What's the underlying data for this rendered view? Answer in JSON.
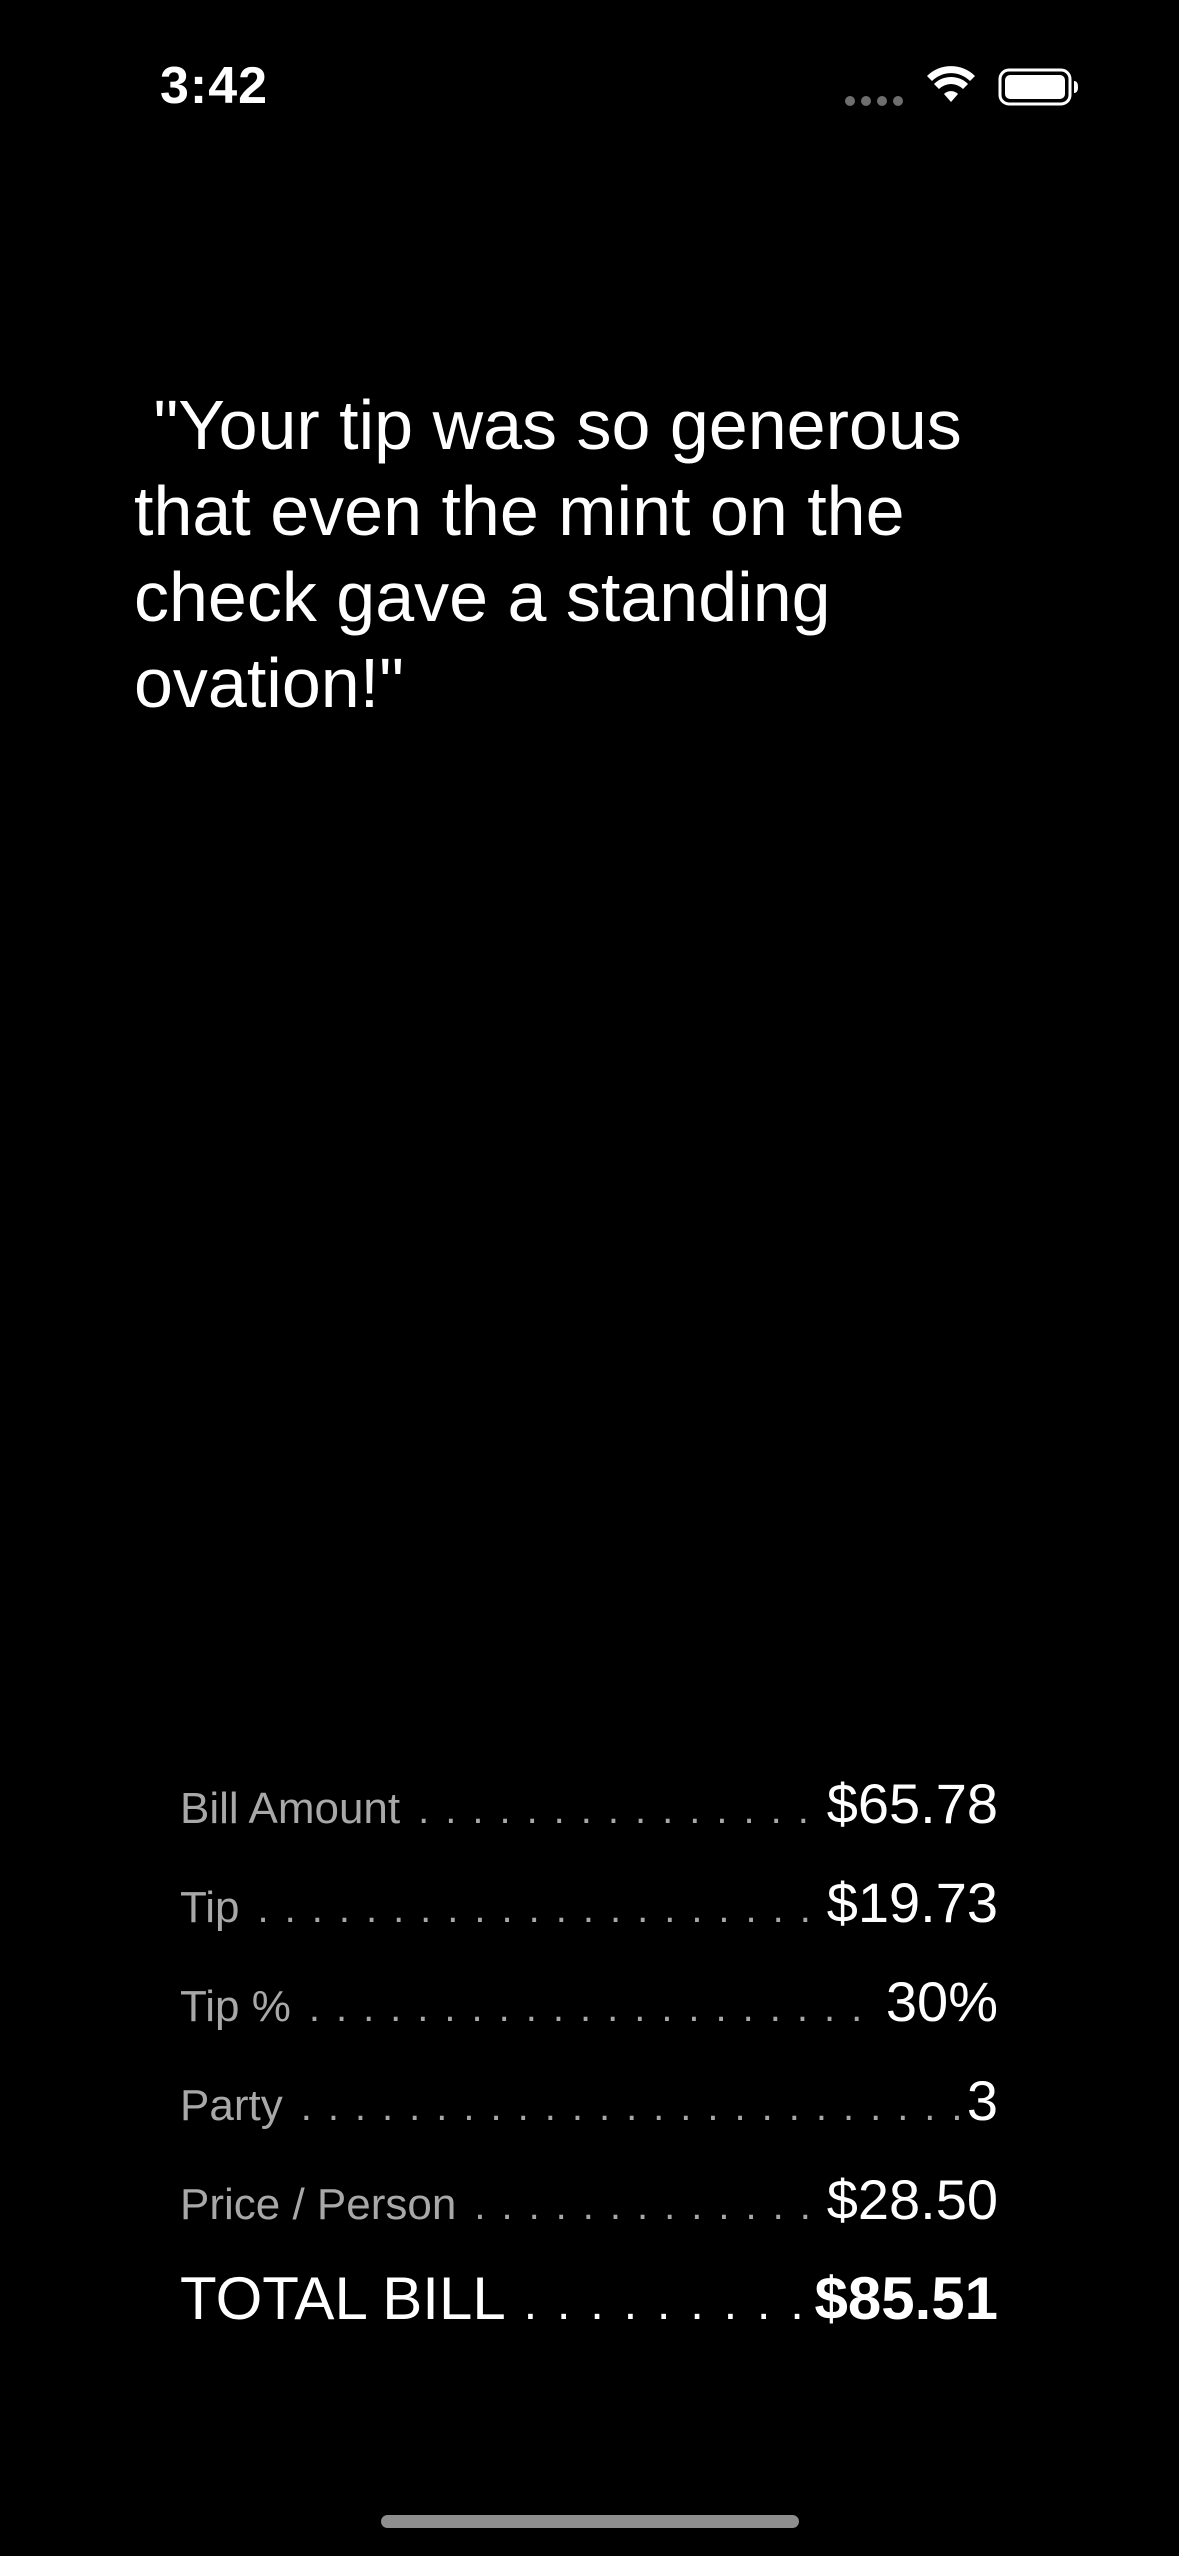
{
  "status_bar": {
    "time": "3:42",
    "icons": [
      "signal-dots-icon",
      "wifi-icon",
      "battery-icon"
    ]
  },
  "quote": {
    "text": " \"Your tip was so generous that even the mint on the check gave a standing ovation!\""
  },
  "summary": {
    "rows": [
      {
        "label": "Bill Amount",
        "value": "$65.78"
      },
      {
        "label": "Tip",
        "value": "$19.73"
      },
      {
        "label": "Tip %",
        "value": "30%"
      },
      {
        "label": "Party",
        "value": "3"
      },
      {
        "label": "Price / Person",
        "value": "$28.50"
      }
    ],
    "total": {
      "label": "TOTAL BILL",
      "value": "$85.51"
    }
  },
  "colors": {
    "background": "#000000",
    "text": "#ffffff",
    "label": "#a8a8a8"
  }
}
